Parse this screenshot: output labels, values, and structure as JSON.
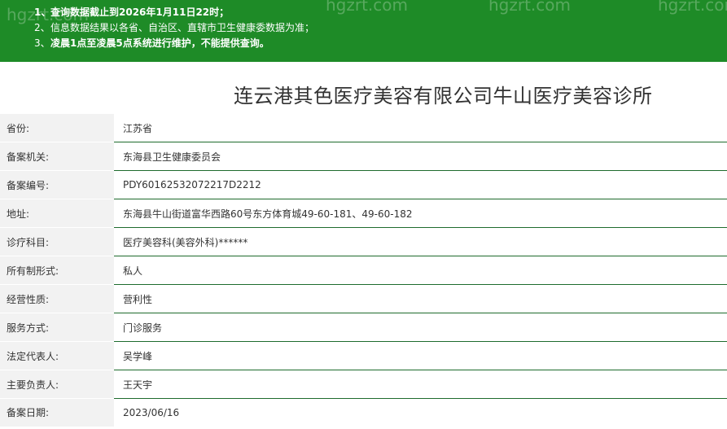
{
  "notice": {
    "items": [
      {
        "num": "1、",
        "text": "查询数据截止到2026年1月11日22时；"
      },
      {
        "num": "2、",
        "text": "信息数据结果以各省、自治区、直辖市卫生健康委数据为准；"
      },
      {
        "num": "3、",
        "text": "凌晨1点至凌晨5点系统进行维护，不能提供查询。"
      }
    ],
    "watermark": "hgzrt.com",
    "colors": {
      "background": "#1e8b27",
      "text": "#ffffff",
      "divider": "#1e6b2d"
    }
  },
  "page_title": "连云港其色医疗美容有限公司牛山医疗美容诊所",
  "rows": [
    {
      "label": "省份:",
      "value": "江苏省"
    },
    {
      "label": "备案机关:",
      "value": "东海县卫生健康委员会"
    },
    {
      "label": "备案编号:",
      "value": "PDY60162532072217D2212"
    },
    {
      "label": "地址:",
      "value": "东海县牛山街道富华西路60号东方体育城49-60-181、49-60-182"
    },
    {
      "label": "诊疗科目:",
      "value": "医疗美容科(美容外科)******"
    },
    {
      "label": "所有制形式:",
      "value": "私人"
    },
    {
      "label": "经营性质:",
      "value": "营利性"
    },
    {
      "label": "服务方式:",
      "value": "门诊服务"
    },
    {
      "label": "法定代表人:",
      "value": "吴学峰"
    },
    {
      "label": "主要负责人:",
      "value": "王天宇"
    },
    {
      "label": "备案日期:",
      "value": "2023/06/16"
    }
  ]
}
